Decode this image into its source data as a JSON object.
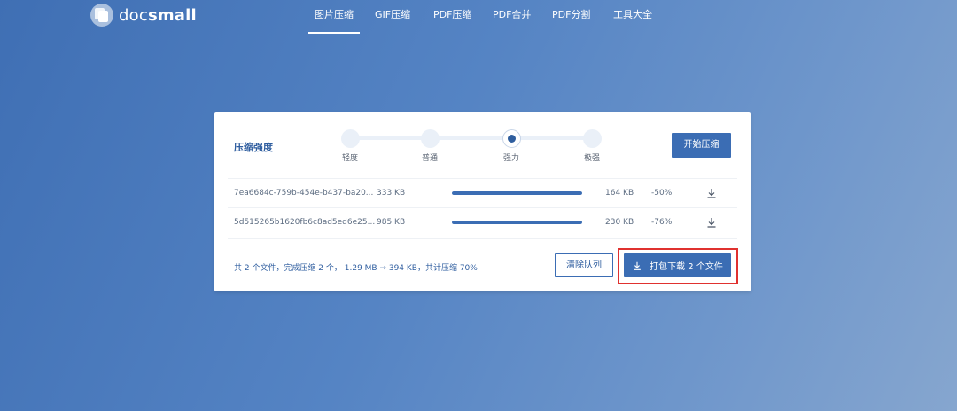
{
  "header": {
    "logo": {
      "text_light": "doc",
      "text_bold": "small"
    },
    "nav": [
      {
        "label": "图片压缩",
        "active": true
      },
      {
        "label": "GIF压缩",
        "active": false
      },
      {
        "label": "PDF压缩",
        "active": false
      },
      {
        "label": "PDF合并",
        "active": false
      },
      {
        "label": "PDF分割",
        "active": false
      },
      {
        "label": "工具大全",
        "active": false
      }
    ]
  },
  "compress": {
    "title": "压缩强度",
    "levels": [
      "轻度",
      "普通",
      "强力",
      "极强"
    ],
    "selected_level": "强力",
    "start_button": "开始压缩"
  },
  "files": [
    {
      "name": "7ea6684c-759b-454e-b437-ba20...",
      "original_size": "333 KB",
      "progress": 1.0,
      "compressed_size": "164 KB",
      "ratio": "-50%",
      "icon": "download-icon"
    },
    {
      "name": "5d515265b1620fb6c8ad5ed6e25...",
      "original_size": "985 KB",
      "progress": 1.0,
      "compressed_size": "230 KB",
      "ratio": "-76%",
      "icon": "download-icon"
    }
  ],
  "footer": {
    "summary": "共 2 个文件，完成压缩 2 个， 1.29 MB → 394 KB，共计压缩 70%",
    "clear_button": "清除队列",
    "download_all_button": "打包下载 2 个文件"
  },
  "colors": {
    "accent": "#3b6db4",
    "title_blue": "#2e5d9f",
    "highlight": "#e0312f"
  }
}
